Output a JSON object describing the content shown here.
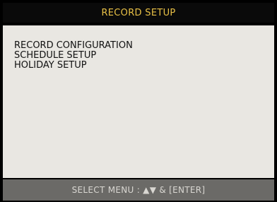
{
  "header": {
    "title": "RECORD SETUP"
  },
  "menu": {
    "items": [
      {
        "label": "RECORD CONFIGURATION"
      },
      {
        "label": "SCHEDULE SETUP"
      },
      {
        "label": "HOLIDAY SETUP"
      }
    ]
  },
  "footer": {
    "hint": "SELECT MENU : ▲▼ & [ENTER]"
  },
  "colors": {
    "title_text": "#e8c046",
    "panel_bg": "#e9e7e2",
    "footer_bg": "#6b6a67",
    "footer_text": "#d9d7d2"
  }
}
